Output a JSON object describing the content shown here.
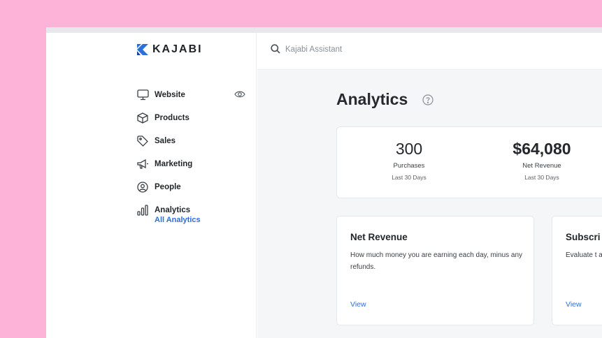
{
  "brand": {
    "name": "KAJABI",
    "color": "#2a6fdb"
  },
  "search": {
    "placeholder": "Kajabi Assistant"
  },
  "sidebar": {
    "items": [
      {
        "label": "Website",
        "icon": "monitor-icon"
      },
      {
        "label": "Products",
        "icon": "box-icon"
      },
      {
        "label": "Sales",
        "icon": "tag-icon"
      },
      {
        "label": "Marketing",
        "icon": "megaphone-icon"
      },
      {
        "label": "People",
        "icon": "person-circle-icon"
      },
      {
        "label": "Analytics",
        "icon": "bar-chart-icon"
      }
    ],
    "active_sub": "All Analytics"
  },
  "page": {
    "title": "Analytics"
  },
  "stats": [
    {
      "value": "300",
      "label": "Purchases",
      "period": "Last 30 Days"
    },
    {
      "value": "$64,080",
      "label": "Net Revenue",
      "period": "Last 30 Days"
    }
  ],
  "cards": [
    {
      "title": "Net Revenue",
      "description": "How much money you are earning each day, minus any refunds.",
      "link": "View"
    },
    {
      "title": "Subscri",
      "description": "Evaluate t analyzing user, and",
      "link": "View"
    }
  ]
}
